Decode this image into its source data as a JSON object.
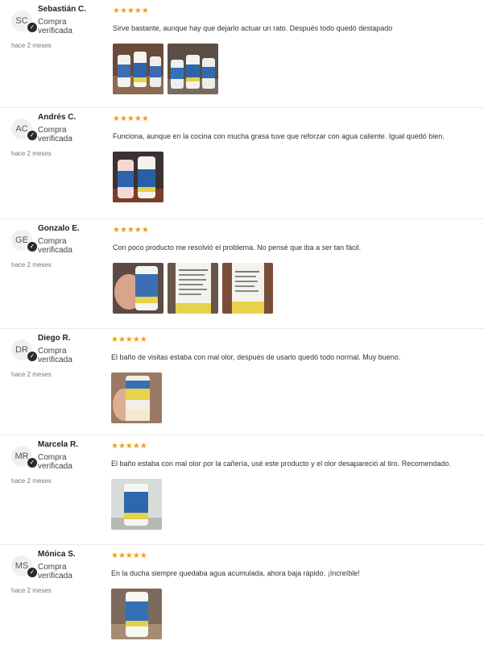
{
  "colors": {
    "star": "#f39c12",
    "divider": "#e9e9e9",
    "badge": "#2b2b2b"
  },
  "reviews": [
    {
      "initials": "SC",
      "name": "Sebastián C.",
      "verified": "Compra verificada",
      "date": "hace 2 meses",
      "rating": 5,
      "stars": "★★★★★",
      "text": "Sirve bastante, aunque hay que dejarlo actuar un rato. Después todo quedó destapado",
      "photos": [
        "bottles-on-counter",
        "bottles-group"
      ]
    },
    {
      "initials": "AC",
      "name": "Andrés C.",
      "verified": "Compra verificada",
      "date": "hace 2 meses",
      "rating": 5,
      "stars": "★★★★★",
      "text": "Funciona, aunque en la cocina con mucha grasa tuve que reforzar con agua caliente. Igual quedó bien.",
      "photos": [
        "two-bottles"
      ]
    },
    {
      "initials": "GE",
      "name": "Gonzalo E.",
      "verified": "Compra verificada",
      "date": "hace 2 meses",
      "rating": 5,
      "stars": "★★★★★",
      "text": "Con poco producto me resolvió el problema. No pensé que iba a ser tan fácil.",
      "photos": [
        "bottle-in-hand",
        "bottle-label-back",
        "bottle-label-side"
      ]
    },
    {
      "initials": "DR",
      "name": "Diego R.",
      "verified": "Compra verificada",
      "date": "hace 2 meses",
      "rating": 5,
      "stars": "★★★★★",
      "text": "El baño de visitas estaba con mal olor, después de usarlo quedó todo normal. Muy bueno.",
      "photos": [
        "bottle-held"
      ]
    },
    {
      "initials": "MR",
      "name": "Marcela R.",
      "verified": "Compra verificada",
      "date": "hace 2 meses",
      "rating": 5,
      "stars": "★★★★★",
      "text": "El baño estaba con mal olor por la cañería, usé este producto y el olor desapareció al tiro. Recomendado.",
      "photos": [
        "bottle-on-table"
      ]
    },
    {
      "initials": "MS",
      "name": "Mónica S.",
      "verified": "Compra verificada",
      "date": "hace 2 meses",
      "rating": 5,
      "stars": "★★★★★",
      "text": "En la ducha siempre quedaba agua acumulada, ahora baja rápido. ¡Increíble!",
      "photos": [
        "bottle-single"
      ]
    }
  ]
}
